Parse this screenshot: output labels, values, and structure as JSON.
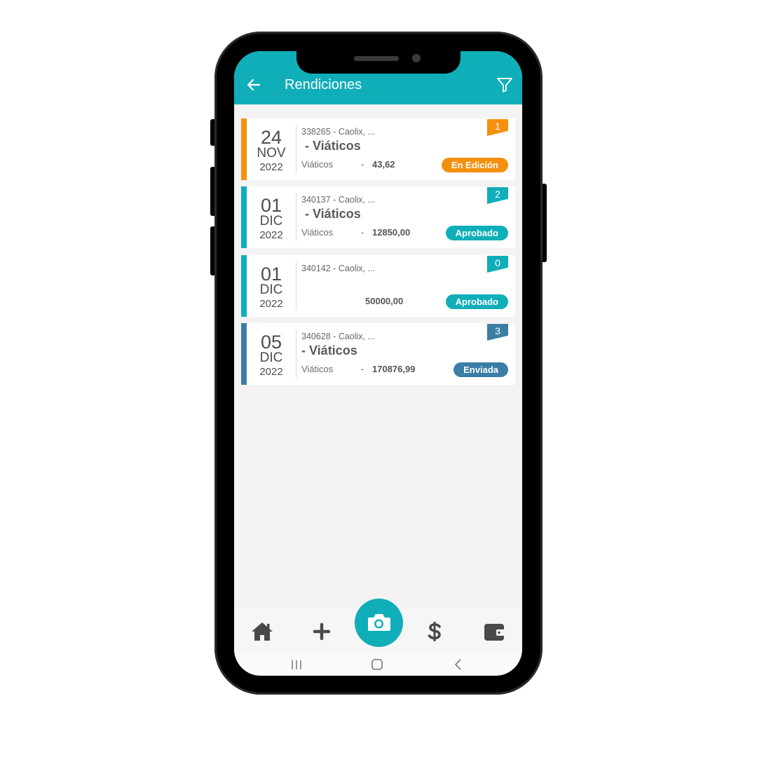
{
  "colors": {
    "primary": "#10aeb9",
    "edicion": "#f5900f",
    "aprobado": "#10aeb9",
    "enviada": "#3a7ea6"
  },
  "appbar": {
    "title": "Rendiciones",
    "back_icon": "arrow-left-icon",
    "filter_icon": "filter-icon"
  },
  "rendiciones": [
    {
      "day": "24",
      "month": "NOV",
      "year": "2022",
      "ref": "338265  -  Caolix, ...",
      "concept": " - Viáticos",
      "category": "Viáticos",
      "separator": "-",
      "amount": "43,62",
      "count": "1",
      "status": "En Edición",
      "status_color": "#f5900f"
    },
    {
      "day": "01",
      "month": "DIC",
      "year": "2022",
      "ref": "340137  -  Caolix, ...",
      "concept": " - Viáticos",
      "category": "Viáticos",
      "separator": "-",
      "amount": "12850,00",
      "count": "2",
      "status": "Aprobado",
      "status_color": "#10aeb9"
    },
    {
      "day": "01",
      "month": "DIC",
      "year": "2022",
      "ref": "340142  -  Caolix, ...",
      "concept": "",
      "category": "",
      "separator": "",
      "amount": "50000,00",
      "count": "0",
      "status": "Aprobado",
      "status_color": "#10aeb9"
    },
    {
      "day": "05",
      "month": "DIC",
      "year": "2022",
      "ref": "340628  -  Caolix, ...",
      "concept": "- Viáticos",
      "category": "Viáticos",
      "separator": "-",
      "amount": "170876,99",
      "count": "3",
      "status": "Enviada",
      "status_color": "#3a7ea6"
    }
  ],
  "bottom_nav": [
    "home-icon",
    "plus-icon",
    "camera-icon",
    "dollar-icon",
    "wallet-icon"
  ],
  "system_nav": [
    "recent-apps-icon",
    "home-button-icon",
    "back-chevron-icon"
  ]
}
